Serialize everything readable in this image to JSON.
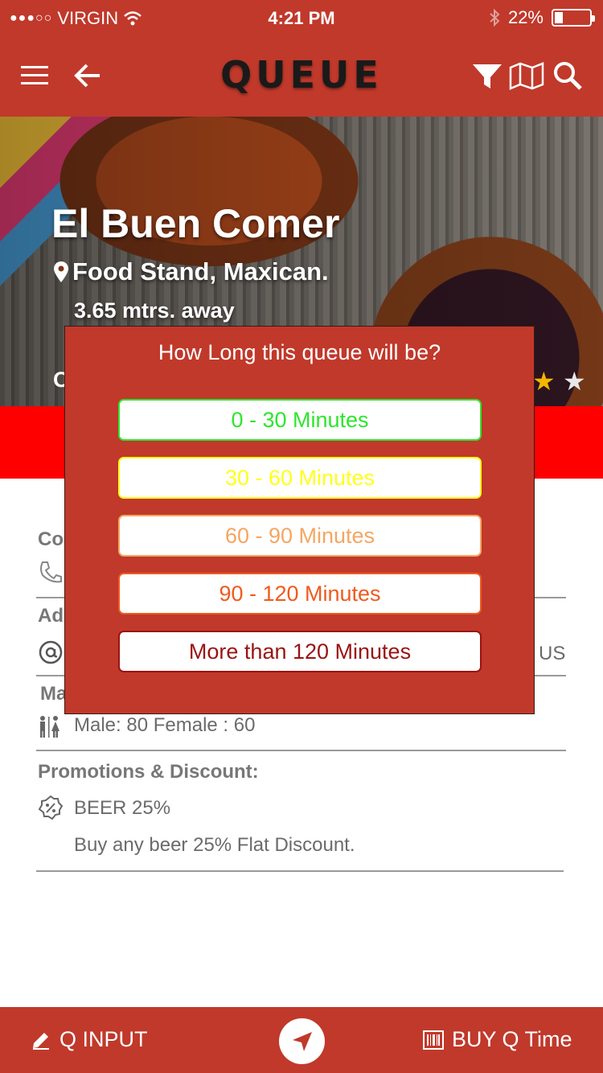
{
  "status_bar": {
    "signal": "●●●○○",
    "carrier": "VIRGIN",
    "time": "4:21 PM",
    "battery": "22%"
  },
  "header": {
    "title": "QUEUE"
  },
  "venue": {
    "name": "El Buen Comer",
    "type": "Food Stand, Maxican.",
    "distance": "3.65 mtrs. away",
    "rating_partial": "C"
  },
  "details": {
    "contact_title": "Co",
    "address_title": "Ad",
    "address_suffix": "US",
    "capacity_title": "Ma",
    "capacity_text": "Male: 80 Female : 60",
    "promotions_title": "Promotions & Discount:",
    "promo_name": "BEER 25%",
    "promo_desc": "Buy any beer 25% Flat Discount."
  },
  "modal": {
    "title": "How Long this queue will be?",
    "options": [
      {
        "label": "0 - 30 Minutes",
        "color": "#2ee62e"
      },
      {
        "label": "30 - 60 Minutes",
        "color": "#ffff1a"
      },
      {
        "label": "60 - 90 Minutes",
        "color": "#f5a662"
      },
      {
        "label": "90 - 120 Minutes",
        "color": "#f05a1e"
      },
      {
        "label": "More than 120 Minutes",
        "color": "#9b1313"
      }
    ]
  },
  "bottom_bar": {
    "left_label": "Q INPUT",
    "right_label": "BUY Q Time"
  },
  "colors": {
    "primary": "#c0392b",
    "band": "#ff0000"
  }
}
